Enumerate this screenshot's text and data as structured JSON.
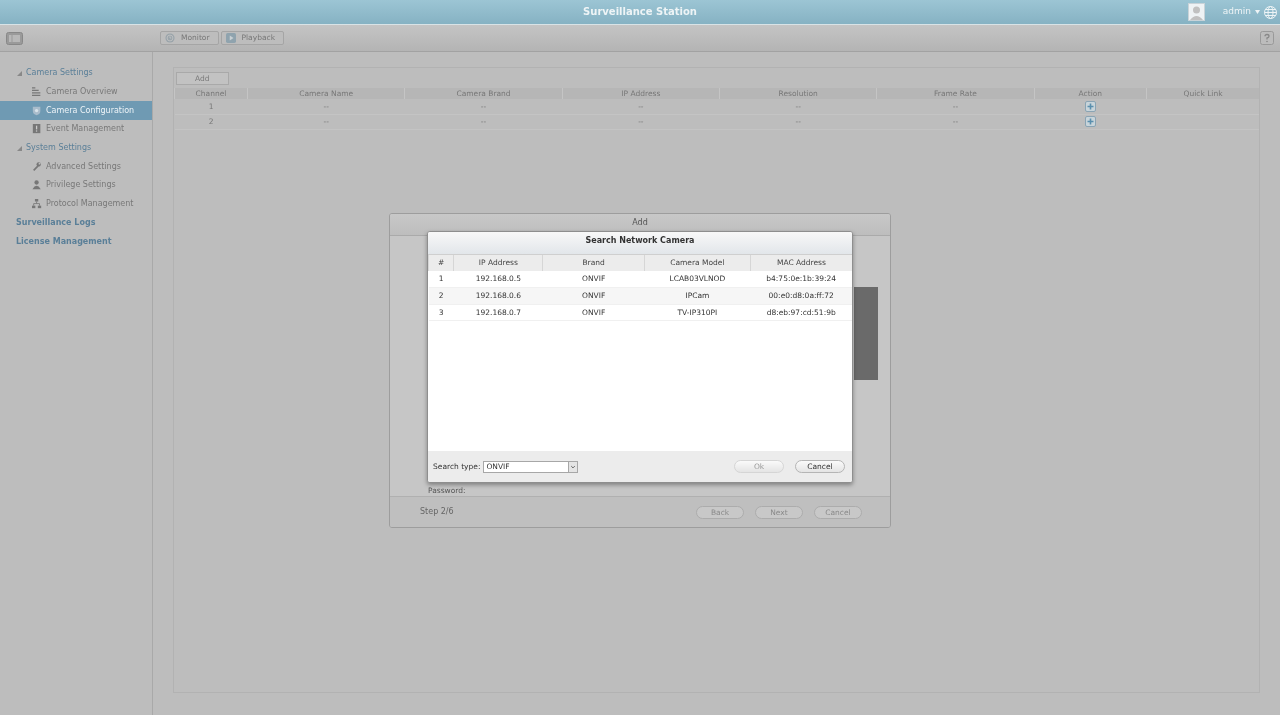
{
  "app": {
    "title": "Surveillance Station",
    "user": "admin"
  },
  "toolbar": {
    "buttons": [
      {
        "label": "Monitor"
      },
      {
        "label": "Playback"
      }
    ]
  },
  "sidebar": {
    "items": [
      {
        "label": "Camera Settings",
        "kind": "group",
        "expanded": true,
        "selected": false,
        "children": [
          {
            "label": "Camera Overview",
            "selected": false
          },
          {
            "label": "Camera Configuration",
            "selected": true
          },
          {
            "label": "Event Management",
            "selected": false
          }
        ]
      },
      {
        "label": "System Settings",
        "kind": "group",
        "expanded": true,
        "selected": false,
        "children": [
          {
            "label": "Advanced Settings",
            "selected": false
          },
          {
            "label": "Privilege Settings",
            "selected": false
          },
          {
            "label": "Protocol Management",
            "selected": false
          }
        ]
      },
      {
        "label": "Surveillance Logs",
        "kind": "link",
        "selected": false
      },
      {
        "label": "License Management",
        "kind": "link",
        "selected": false
      }
    ]
  },
  "channels": {
    "add_button": "Add",
    "columns": [
      "Channel",
      "Camera Name",
      "Camera Brand",
      "IP Address",
      "Resolution",
      "Frame Rate",
      "Action",
      "Quick Link"
    ],
    "rows": [
      {
        "channel": "1",
        "name": "--",
        "brand": "--",
        "ip": "--",
        "resolution": "--",
        "frame_rate": "--"
      },
      {
        "channel": "2",
        "name": "--",
        "brand": "--",
        "ip": "--",
        "resolution": "--",
        "frame_rate": "--"
      }
    ]
  },
  "add_dialog": {
    "title": "Add",
    "password_label": "Password:",
    "step": "Step 2/6",
    "buttons": [
      "Back",
      "Next",
      "Cancel"
    ]
  },
  "search_dialog": {
    "title": "Search Network Camera",
    "columns": [
      "#",
      "IP Address",
      "Brand",
      "Camera Model",
      "MAC Address"
    ],
    "rows": [
      [
        "1",
        "192.168.0.5",
        "ONVIF",
        "LCAB03VLNOD",
        "b4:75:0e:1b:39:24"
      ],
      [
        "2",
        "192.168.0.6",
        "ONVIF",
        "IPCam",
        "00:e0:d8:0a:ff:72"
      ],
      [
        "3",
        "192.168.0.7",
        "ONVIF",
        "TV-IP310PI",
        "d8:eb:97:cd:51:9b"
      ]
    ],
    "search_type_label": "Search type:",
    "search_type": "ONVIF",
    "ok": {
      "label": "Ok",
      "disabled": true
    },
    "cancel": {
      "label": "Cancel",
      "disabled": false
    }
  }
}
